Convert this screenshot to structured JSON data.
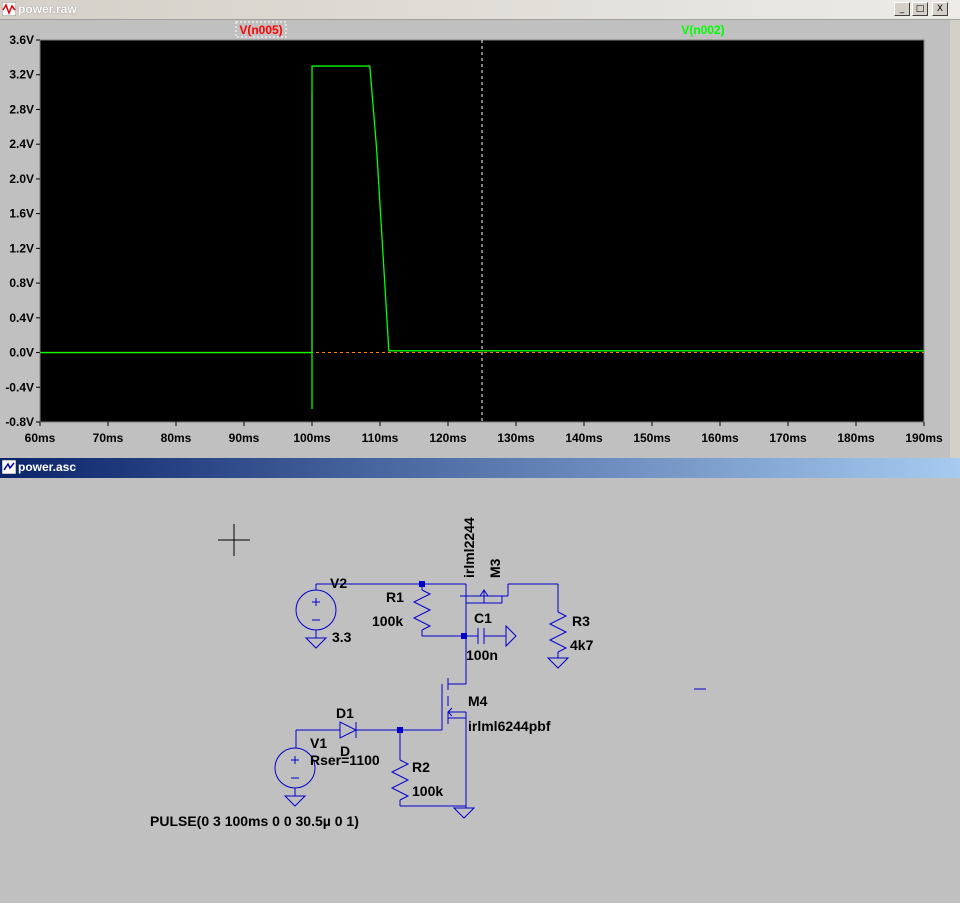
{
  "plot_window": {
    "title": "power.raw",
    "buttons": {
      "minimize": "_",
      "restore": "□",
      "close": "X"
    }
  },
  "schematic_window": {
    "title": "power.asc"
  },
  "chart_data": {
    "type": "line",
    "xlabel": "",
    "ylabel": "",
    "xlim": [
      60,
      190
    ],
    "ylim": [
      -0.8,
      3.6
    ],
    "x_ticks": [
      "60ms",
      "70ms",
      "80ms",
      "90ms",
      "100ms",
      "110ms",
      "120ms",
      "130ms",
      "140ms",
      "150ms",
      "160ms",
      "170ms",
      "180ms",
      "190ms"
    ],
    "y_ticks": [
      "3.6V",
      "3.2V",
      "2.8V",
      "2.4V",
      "2.0V",
      "1.6V",
      "1.2V",
      "0.8V",
      "0.4V",
      "0.0V",
      "-0.4V",
      "-0.8V"
    ],
    "cursor_x": 125,
    "series": [
      {
        "name": "V(n005)",
        "color": "#ff0000",
        "x": [
          60,
          100,
          100,
          100
        ],
        "y": [
          0,
          0,
          3.0,
          3.0
        ]
      },
      {
        "name": "V(n002)",
        "color": "#00ff00",
        "x": [
          60,
          100,
          100,
          100,
          108.5,
          109.5,
          111.3,
          190
        ],
        "y": [
          0,
          0,
          -0.65,
          3.3,
          3.3,
          2.35,
          0.02,
          0.02
        ]
      }
    ]
  },
  "schematic": {
    "components": {
      "V2": {
        "name": "V2",
        "value": "3.3"
      },
      "R1": {
        "name": "R1",
        "value": "100k"
      },
      "M3": {
        "name": "M3",
        "value": "irlml2244"
      },
      "C1": {
        "name": "C1",
        "value": "100n"
      },
      "R3": {
        "name": "R3",
        "value": "4k7"
      },
      "M4": {
        "name": "M4",
        "value": "irlml6244pbf"
      },
      "D1": {
        "name": "D1",
        "value": "D"
      },
      "V1": {
        "name": "V1",
        "rser": "Rser=1100",
        "spice": "PULSE(0 3 100ms 0 0 30.5µ 0 1)"
      },
      "R2": {
        "name": "R2",
        "value": "100k"
      }
    }
  },
  "colors": {
    "plot_bg": "#000000",
    "grid_label": "#ffffff",
    "schematic_wire": "#0000cc",
    "schematic_text": "#000000",
    "schematic_bg": "#c0c0c0"
  }
}
